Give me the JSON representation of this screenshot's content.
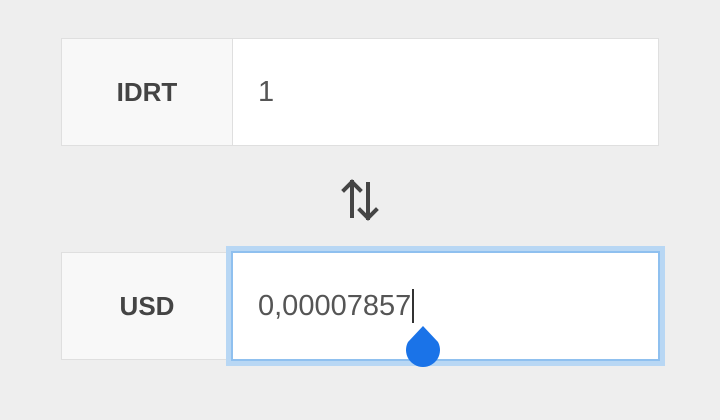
{
  "converter": {
    "from": {
      "currency": "IDRT",
      "value": "1"
    },
    "to": {
      "currency": "USD",
      "value": "0,00007857"
    },
    "swap_icon": "swap-vertical-arrows-icon",
    "colors": {
      "background": "#eeeeee",
      "label_bg": "#f8f8f8",
      "focus_ring": "#b8d7f4",
      "handle": "#1a73e8"
    }
  }
}
